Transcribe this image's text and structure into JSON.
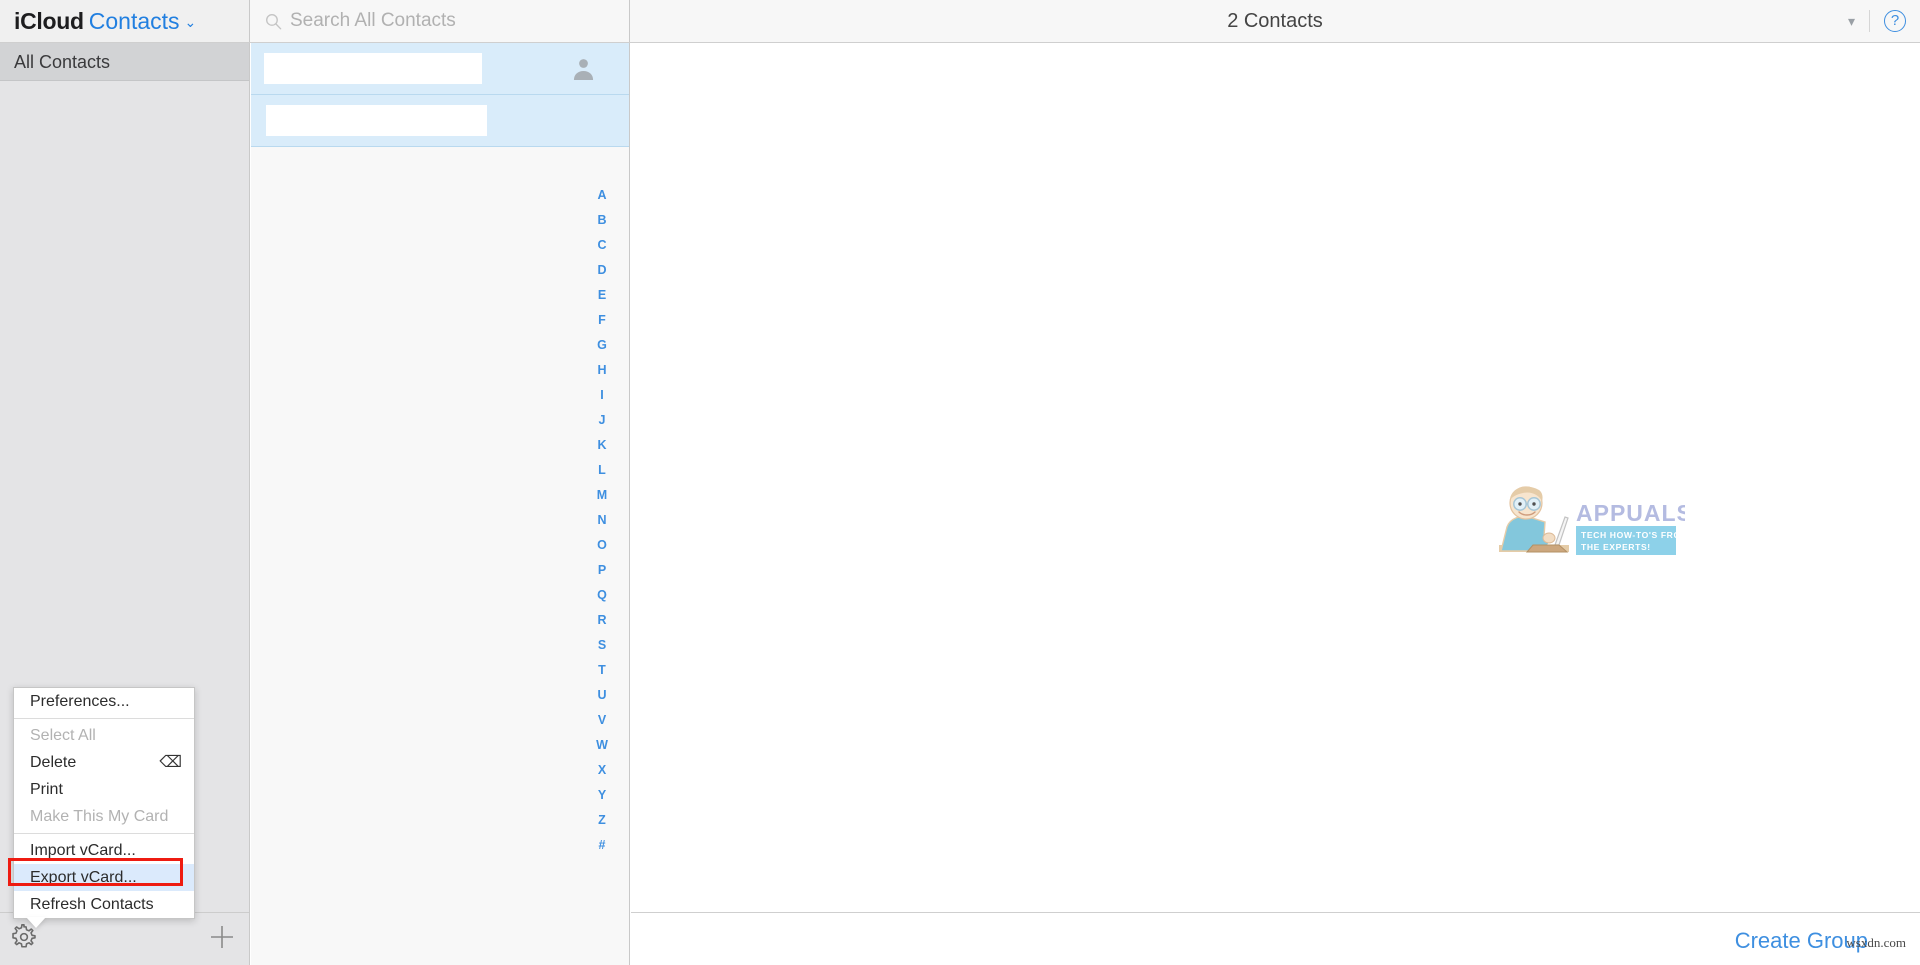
{
  "window": {
    "brand_primary": "iCloud",
    "brand_app": "Contacts",
    "brand_chevron": "⌄"
  },
  "search": {
    "placeholder": "Search All Contacts",
    "value": "",
    "icon": "search-icon"
  },
  "header": {
    "title": "2 Contacts",
    "chevron_icon": "chevron-down-icon",
    "help_icon": "question-mark-icon",
    "help_label": "?"
  },
  "sidebar": {
    "items": [
      {
        "label": "All Contacts",
        "selected": true
      }
    ],
    "footer": {
      "settings_icon": "gear-icon",
      "add_icon": "plus-icon"
    }
  },
  "contacts_list": {
    "rows": [
      {
        "name": "",
        "redacted": true,
        "selected": true,
        "has_avatar": true
      },
      {
        "name": "",
        "redacted": true,
        "selected": true,
        "has_avatar": false
      }
    ],
    "alphabet_index": [
      "A",
      "B",
      "C",
      "D",
      "E",
      "F",
      "G",
      "H",
      "I",
      "J",
      "K",
      "L",
      "M",
      "N",
      "O",
      "P",
      "Q",
      "R",
      "S",
      "T",
      "U",
      "V",
      "W",
      "X",
      "Y",
      "Z",
      "#"
    ]
  },
  "main": {
    "create_group_label": "Create Group",
    "watermark_brand": "APPUALS",
    "watermark_tagline_line1": "TECH HOW-TO'S FROM",
    "watermark_tagline_line2": "THE EXPERTS!",
    "source_watermark": "wsxdn.com"
  },
  "context_menu": {
    "groups": [
      [
        {
          "label": "Preferences...",
          "disabled": false,
          "highlighted": false,
          "shortcut": ""
        }
      ],
      [
        {
          "label": "Select All",
          "disabled": true,
          "highlighted": false,
          "shortcut": ""
        },
        {
          "label": "Delete",
          "disabled": false,
          "highlighted": false,
          "shortcut": "⌫"
        },
        {
          "label": "Print",
          "disabled": false,
          "highlighted": false,
          "shortcut": ""
        },
        {
          "label": "Make This My Card",
          "disabled": true,
          "highlighted": false,
          "shortcut": ""
        }
      ],
      [
        {
          "label": "Import vCard...",
          "disabled": false,
          "highlighted": false,
          "shortcut": ""
        },
        {
          "label": "Export vCard...",
          "disabled": false,
          "highlighted": true,
          "shortcut": ""
        },
        {
          "label": "Refresh Contacts",
          "disabled": false,
          "highlighted": false,
          "shortcut": ""
        }
      ]
    ]
  },
  "colors": {
    "accent_blue": "#3e8fe0",
    "selection_blue": "#d9ecfa",
    "highlight_red": "#ee1b11",
    "sidebar_gray": "#e4e4e6",
    "sidebar_selected": "#d2d3d5"
  }
}
